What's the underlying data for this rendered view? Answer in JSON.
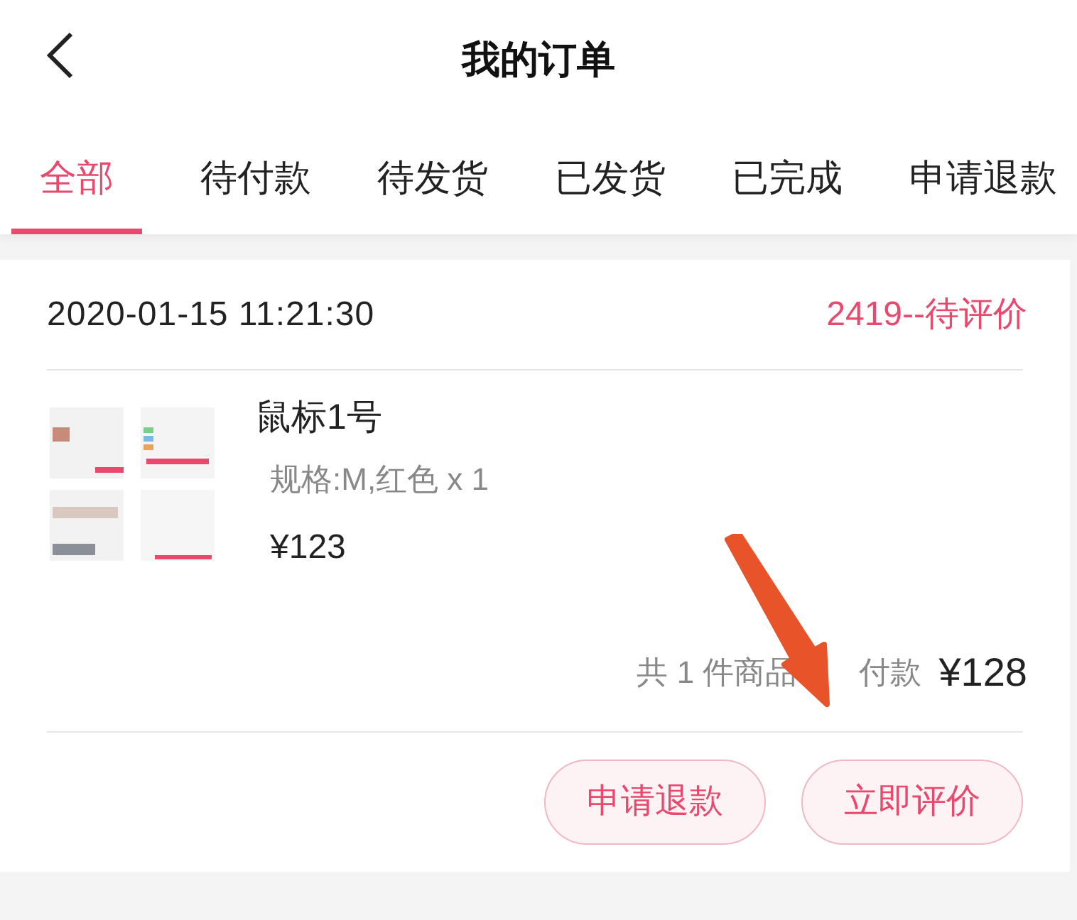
{
  "header": {
    "title": "我的订单"
  },
  "tabs": [
    {
      "label": "全部",
      "selected": true
    },
    {
      "label": "待付款",
      "selected": false
    },
    {
      "label": "待发货",
      "selected": false
    },
    {
      "label": "已发货",
      "selected": false
    },
    {
      "label": "已完成",
      "selected": false
    },
    {
      "label": "申请退款",
      "selected": false
    }
  ],
  "orders": [
    {
      "time": "2020-01-15 11:21:30",
      "status": "2419--待评价",
      "item": {
        "name": "鼠标1号",
        "spec": "规格:M,红色 x 1",
        "price": "¥123"
      },
      "summary": {
        "count": "共 1 件商品",
        "paid_label": "付款",
        "total": "¥128"
      },
      "buttons": [
        "申请退款",
        "立即评价"
      ]
    }
  ]
}
